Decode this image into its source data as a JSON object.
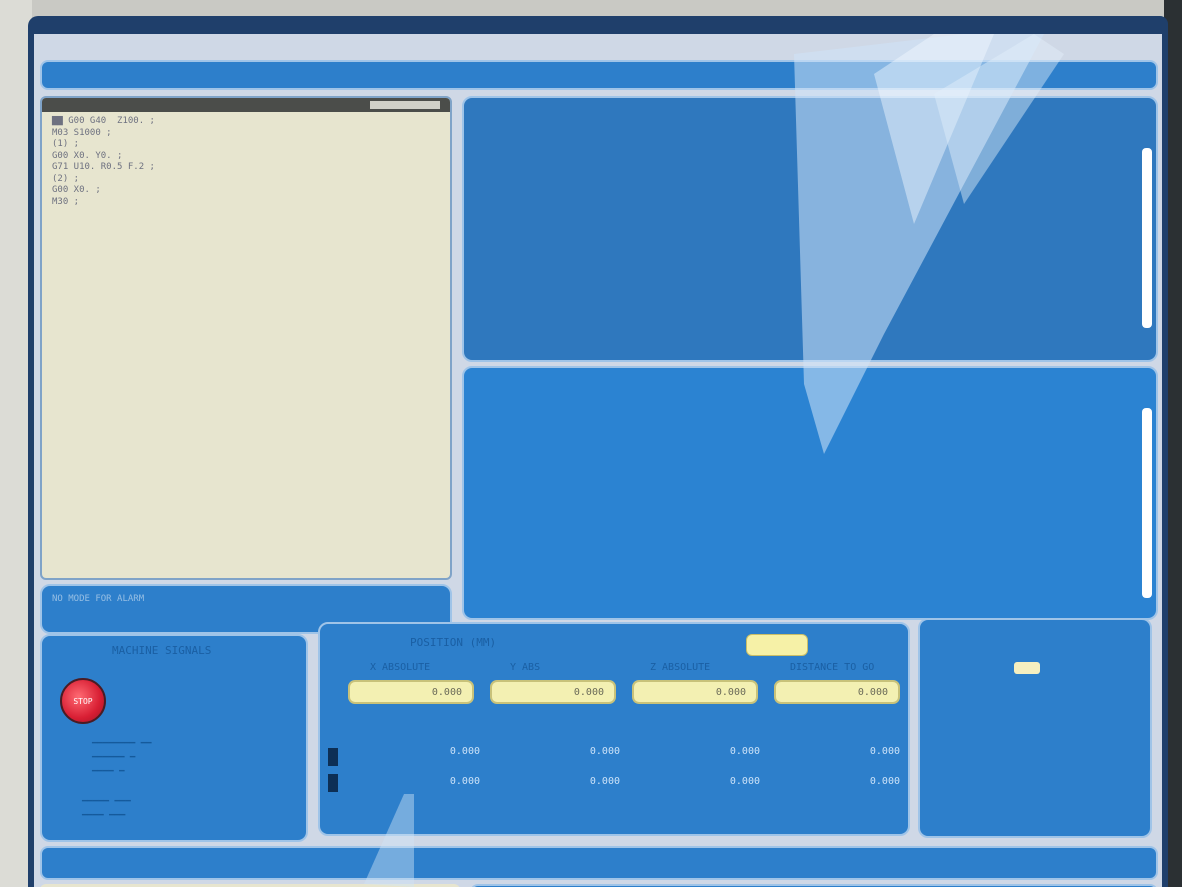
{
  "editor": {
    "lines": [
      "▇▇ G00 G40  Z100. ;",
      "M03 S1000 ;",
      "(1) ;",
      "G00 X0. Y0. ;",
      "G71 U10. R0.5 F.2 ;",
      "(2) ;",
      "G00 X0. ;",
      "",
      "M30 ;"
    ]
  },
  "message": {
    "line1": "NO MODE FOR ALARM",
    "line2": ""
  },
  "signals": {
    "title": "MACHINE SIGNALS",
    "stop_label": "STOP"
  },
  "position": {
    "title": "POSITION (MM)",
    "columns": [
      "X ABSOLUTE",
      "Y ABS",
      "Z ABSOLUTE",
      "DISTANCE TO GO"
    ],
    "fields": [
      "0.000",
      "0.000",
      "0.000",
      "0.000"
    ],
    "row1": [
      "0.000",
      "0.000",
      "0.000",
      "0.000"
    ],
    "row2": [
      "0.000",
      "0.000",
      "0.000",
      "0.000"
    ]
  },
  "info": {
    "lines": [
      "",
      "",
      "",
      ""
    ]
  },
  "colors": {
    "panel": "#2d7fcb",
    "editor_bg": "#e7e5cf",
    "field_yellow": "#f3f0b2",
    "stop_red": "#d81e33"
  }
}
